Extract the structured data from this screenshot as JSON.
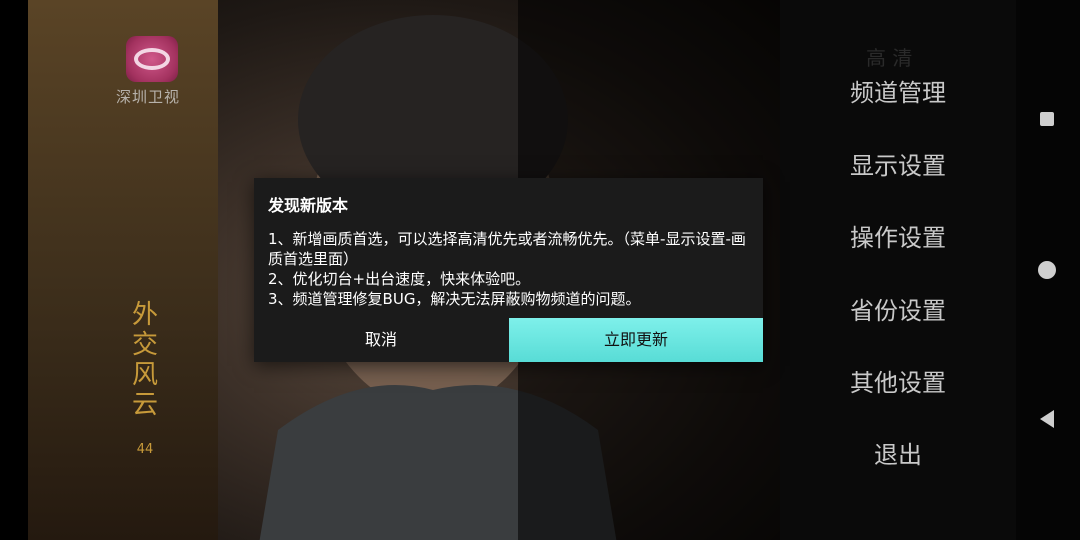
{
  "channel": {
    "logo_text": "深圳卫视"
  },
  "program": {
    "title": "外交风云",
    "episode": "44"
  },
  "menu": {
    "ghost_label": "高 清",
    "items": [
      "频道管理",
      "显示设置",
      "操作设置",
      "省份设置",
      "其他设置",
      "退出"
    ]
  },
  "dialog": {
    "title": "发现新版本",
    "lines": [
      "1、新增画质首选，可以选择高清优先或者流畅优先。（菜单-显示设置-画质首选里面）",
      "2、优化切台+出台速度，快来体验吧。",
      "3、频道管理修复BUG，解决无法屏蔽购物频道的问题。"
    ],
    "cancel_label": "取消",
    "update_label": "立即更新"
  },
  "colors": {
    "accent": "#66e3dd",
    "dialog_bg": "#1b1b1b",
    "title_gold": "#c79a3a"
  },
  "navbar": {
    "icons": [
      "recents-square-icon",
      "home-circle-icon",
      "back-triangle-icon"
    ]
  }
}
